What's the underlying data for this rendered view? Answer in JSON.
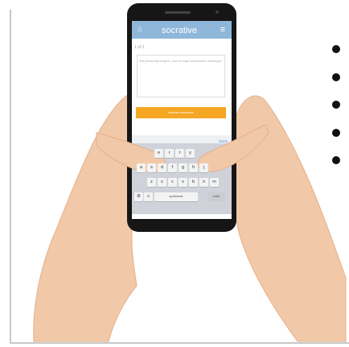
{
  "app": {
    "title": "socrative",
    "left_icon": "⌂",
    "menu_icon": "≡"
  },
  "question": {
    "counter": "1 of 1",
    "answer_placeholder": "Wat persoonlijk vergat ik, door en eigen antwoorden, anderingen",
    "submit_label": "indienen antwoorde"
  },
  "keyboard": {
    "done_label": "Done",
    "row1": [
      "e",
      "r",
      "t",
      "y"
    ],
    "row2": [
      "a",
      "s",
      "d",
      "f",
      "g",
      "h",
      "j"
    ],
    "row3": [
      "z",
      "x",
      "c",
      "v",
      "b",
      "n",
      "m"
    ],
    "space_label": "spatiebalk",
    "enter_label": "enter",
    "globe_icon": "⚙",
    "emoji_icon": "☺"
  },
  "bullets": [
    {
      "id": "b1"
    },
    {
      "id": "b2"
    },
    {
      "id": "b3"
    },
    {
      "id": "b4"
    },
    {
      "id": "b5"
    }
  ],
  "colors": {
    "header": "#8fb7d9",
    "submit": "#f5a623",
    "skin": "#f2c9a8",
    "skin_shade": "#e8b28d",
    "phone": "#161616",
    "keyboard_bg": "#cfd3d9"
  }
}
